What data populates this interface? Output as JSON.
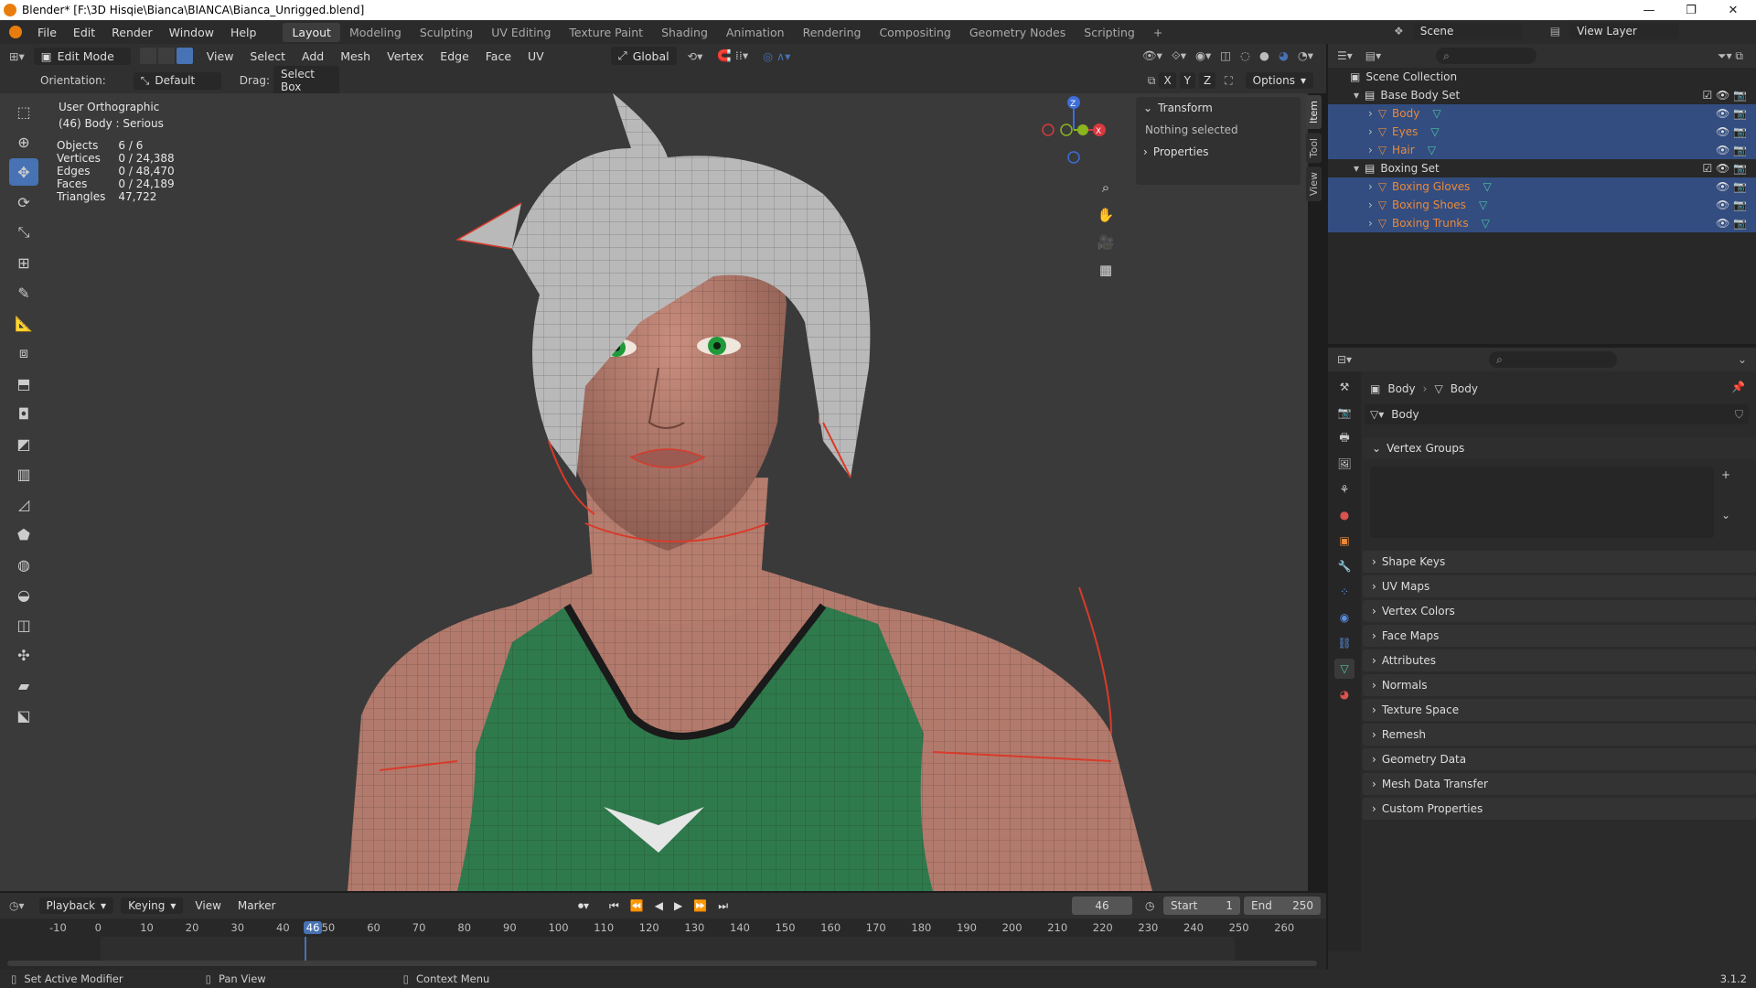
{
  "window": {
    "title": "Blender* [F:\\3D Hisqie\\Bianca\\BIANCA\\Bianca_Unrigged.blend]",
    "minimize": "—",
    "maximize": "❐",
    "close": "✕"
  },
  "menu": [
    "File",
    "Edit",
    "Render",
    "Window",
    "Help"
  ],
  "workspaces": [
    "Layout",
    "Modeling",
    "Sculpting",
    "UV Editing",
    "Texture Paint",
    "Shading",
    "Animation",
    "Rendering",
    "Compositing",
    "Geometry Nodes",
    "Scripting"
  ],
  "workspace_add": "+",
  "scene": {
    "label": "Scene",
    "view_layer": "View Layer"
  },
  "viewport_header": {
    "mode": "Edit Mode",
    "menus": [
      "View",
      "Select",
      "Add",
      "Mesh",
      "Vertex",
      "Edge",
      "Face",
      "UV"
    ],
    "transform": "Global"
  },
  "tool_settings": {
    "orientation_label": "Orientation:",
    "orientation_value": "Default",
    "drag_label": "Drag:",
    "drag_value": "Select Box",
    "axes": [
      "X",
      "Y",
      "Z"
    ],
    "options": "Options"
  },
  "overlay": {
    "view_name": "User Orthographic",
    "object_info": "(46) Body : Serious",
    "stats": [
      {
        "label": "Objects",
        "value": "6 / 6"
      },
      {
        "label": "Vertices",
        "value": "0 / 24,388"
      },
      {
        "label": "Edges",
        "value": "0 / 48,470"
      },
      {
        "label": "Faces",
        "value": "0 / 24,189"
      },
      {
        "label": "Triangles",
        "value": "47,722"
      }
    ]
  },
  "npanel": {
    "transform": "Transform",
    "nothing_selected": "Nothing selected",
    "properties": "Properties",
    "tabs": [
      "Item",
      "Tool",
      "View"
    ]
  },
  "outliner": {
    "collection": "Scene Collection",
    "groups": [
      {
        "name": "Base Body Set",
        "items": [
          "Body",
          "Eyes",
          "Hair"
        ]
      },
      {
        "name": "Boxing Set",
        "items": [
          "Boxing Gloves",
          "Boxing Shoes",
          "Boxing Trunks"
        ]
      }
    ]
  },
  "properties": {
    "breadcrumb_object": "Body",
    "breadcrumb_data": "Body",
    "data_name": "Body",
    "vertex_groups": "Vertex Groups",
    "panels": [
      "Shape Keys",
      "UV Maps",
      "Vertex Colors",
      "Face Maps",
      "Attributes",
      "Normals",
      "Texture Space",
      "Remesh",
      "Geometry Data",
      "Mesh Data Transfer",
      "Custom Properties"
    ]
  },
  "timeline": {
    "menus": [
      "Playback",
      "Keying",
      "View",
      "Marker"
    ],
    "current_frame": "46",
    "start_label": "Start",
    "start": "1",
    "end_label": "End",
    "end": "250",
    "ruler": [
      "-10",
      "0",
      "10",
      "20",
      "30",
      "40",
      "46",
      "50",
      "60",
      "70",
      "80",
      "90",
      "100",
      "110",
      "120",
      "130",
      "140",
      "150",
      "160",
      "170",
      "180",
      "190",
      "200",
      "210",
      "220",
      "230",
      "240",
      "250",
      "260"
    ]
  },
  "statusbar": {
    "left": "Set Active Modifier",
    "middle": "Pan View",
    "right": "Context Menu",
    "version": "3.1.2"
  },
  "colors": {
    "accent": "#4772b3",
    "selected_row": "#334d80",
    "object_orange": "#e9893a",
    "edge_red": "#d93a2a",
    "shirt_green": "#2f7a4c"
  }
}
